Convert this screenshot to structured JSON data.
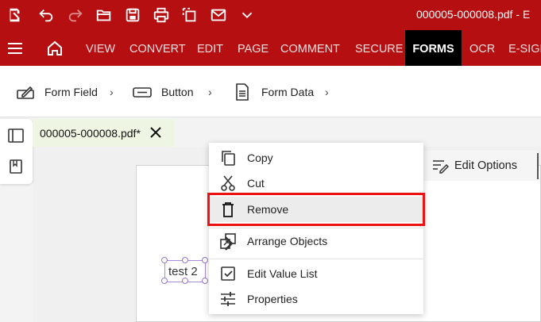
{
  "titlebar": {
    "document_title": "000005-000008.pdf  -  E",
    "icons": [
      "app-logo-icon",
      "undo-icon",
      "redo-icon",
      "open-folder-icon",
      "save-icon",
      "print-icon",
      "scan-icon",
      "mail-icon",
      "chevron-down-icon"
    ]
  },
  "menu": {
    "items": [
      {
        "label": "VIEW"
      },
      {
        "label": "CONVERT"
      },
      {
        "label": "EDIT"
      },
      {
        "label": "PAGE"
      },
      {
        "label": "COMMENT"
      },
      {
        "label": "SECURE"
      },
      {
        "label": "FORMS",
        "active": true
      },
      {
        "label": "OCR"
      },
      {
        "label": "E-SIGN"
      }
    ]
  },
  "ribbon": {
    "items": [
      {
        "label": "Form Field",
        "icon": "form-field-icon"
      },
      {
        "label": "Button",
        "icon": "button-icon"
      },
      {
        "label": "Form Data",
        "icon": "form-data-icon"
      }
    ],
    "chevron": "›"
  },
  "tab": {
    "filename": "000005-000008.pdf*"
  },
  "toolbar": {
    "edit_options": "Edit Options"
  },
  "field": {
    "text": "test 2"
  },
  "context_menu": {
    "items": [
      {
        "label": "Copy",
        "icon": "copy-icon"
      },
      {
        "label": "Cut",
        "icon": "scissors-icon"
      },
      {
        "label": "Remove",
        "icon": "trash-icon",
        "highlighted": true
      },
      {
        "label": "Arrange Objects",
        "icon": "arrange-objects-icon",
        "submenu": true
      },
      {
        "label": "Edit Value List",
        "icon": "checkbox-icon"
      },
      {
        "label": "Properties",
        "icon": "properties-icon"
      }
    ]
  },
  "colors": {
    "titlebar_bg": "#b50f12",
    "active_tab_bg": "#000000",
    "highlight_border": "#ee1111",
    "doc_tab_bg": "#eef6e3"
  }
}
